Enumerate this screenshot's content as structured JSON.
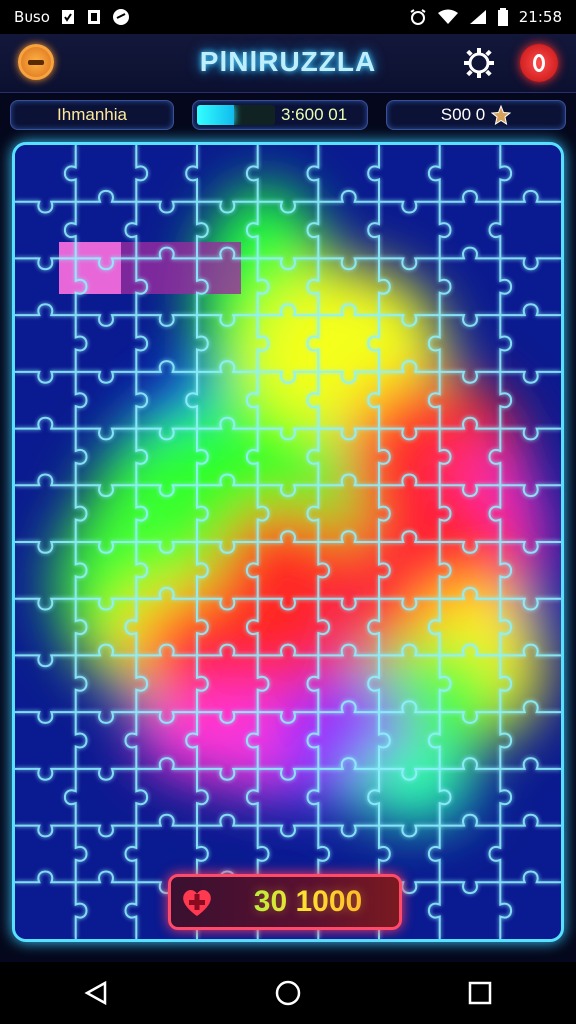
{
  "status_bar": {
    "left_text": "Bᴜѕо",
    "time": "21:58",
    "icons": [
      "notification-icon",
      "clipboard-icon",
      "app-icon",
      "alarm-icon",
      "wifi-icon",
      "signal-icon",
      "battery-icon"
    ]
  },
  "header": {
    "title": "PlNlRUZZLA"
  },
  "info_bar": {
    "left_label": "Ihmanhia",
    "timer_text": "3:600 01",
    "progress_percent": 48,
    "right_label": "S00 0"
  },
  "board": {
    "rows": 14,
    "cols": 9
  },
  "score": {
    "value": "30 1000"
  },
  "colors": {
    "accent_cyan": "#58e0ff",
    "board_bg": "#0a1a8e",
    "score_border": "#ff4a6a"
  }
}
